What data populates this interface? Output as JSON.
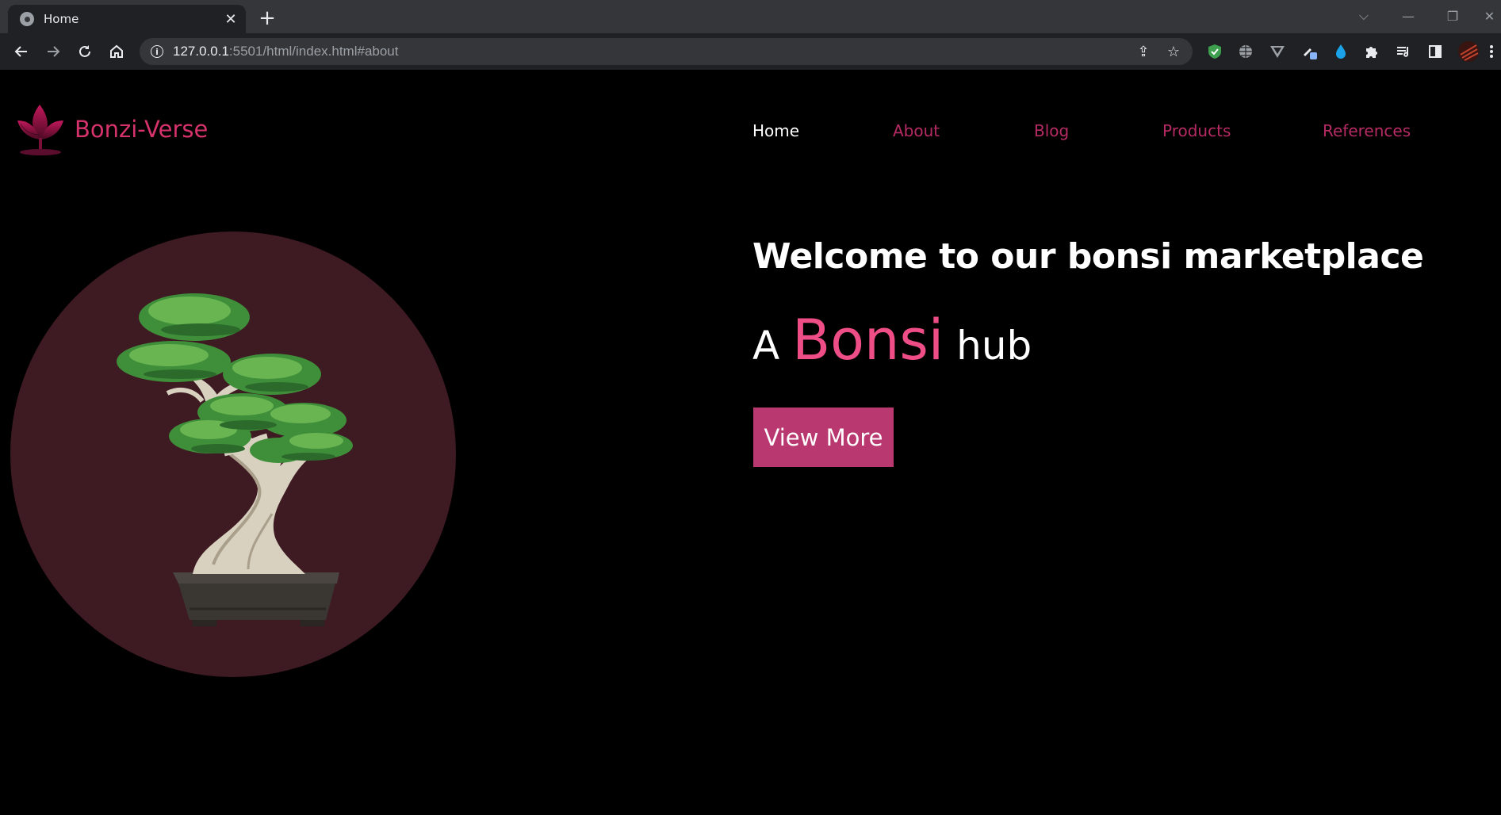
{
  "browser": {
    "tab_title": "Home",
    "tab_close": "✕",
    "new_tab": "+",
    "url_host": "127.0.0.1",
    "url_rest": ":5501/html/index.html#about",
    "window_controls": [
      "⌵",
      "—",
      "❐",
      "✕"
    ],
    "extensions": [
      "shield-check-icon",
      "globe-icon",
      "vimium-icon",
      "pen-icon",
      "droplet-icon",
      "puzzle-icon",
      "media-queue-icon",
      "sidebar-icon",
      "profile-avatar",
      "more-icon"
    ]
  },
  "site": {
    "brand": "Bonzi-Verse",
    "nav": [
      {
        "label": "Home",
        "active": true
      },
      {
        "label": "About",
        "active": false
      },
      {
        "label": "Blog",
        "active": false
      },
      {
        "label": "Products",
        "active": false
      },
      {
        "label": "References",
        "active": false
      }
    ],
    "hero": {
      "welcome": "Welcome to our bonsi marketplace",
      "tagline_prefix": "A",
      "tagline_accent": "Bonsi",
      "tagline_suffix": "hub",
      "button": "View More"
    }
  },
  "colors": {
    "brand_pink": "#d6336c",
    "nav_pink": "#b62b63",
    "accent_pink": "#ef4d86",
    "button_bg": "#b93870",
    "circle_bg": "#3e1a22"
  }
}
